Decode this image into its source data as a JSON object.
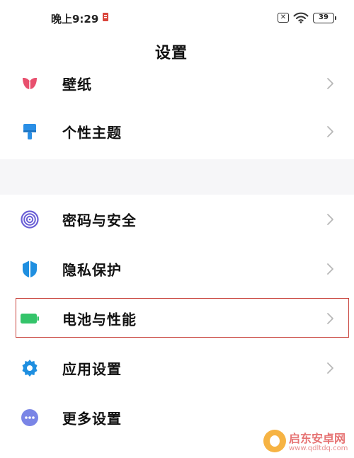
{
  "status_bar": {
    "time": "晚上9:29",
    "battery": "39"
  },
  "page": {
    "title": "设置"
  },
  "items": [
    {
      "label": "壁纸",
      "icon": "wallpaper-icon"
    },
    {
      "label": "个性主题",
      "icon": "theme-brush-icon"
    },
    {
      "label": "密码与安全",
      "icon": "fingerprint-icon"
    },
    {
      "label": "隐私保护",
      "icon": "privacy-shield-icon"
    },
    {
      "label": "电池与性能",
      "icon": "battery-icon",
      "highlighted": true
    },
    {
      "label": "应用设置",
      "icon": "gear-icon"
    },
    {
      "label": "更多设置",
      "icon": "more-icon"
    }
  ],
  "watermark": {
    "text": "启东安卓网",
    "url": "www.qdltdq.com"
  },
  "colors": {
    "wallpaper": "#e8506e",
    "theme": "#2a8fe6",
    "password": "#6a5fd6",
    "privacy": "#1f8fe0",
    "battery": "#34c46a",
    "app_settings": "#1f8fe0",
    "more": "#7a85e6",
    "highlight_border": "#c9453e"
  }
}
